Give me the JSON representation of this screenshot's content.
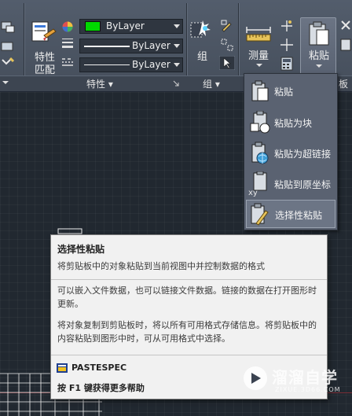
{
  "ribbon": {
    "match_properties_label": "特性\n匹配",
    "match_properties_line1": "特性",
    "match_properties_line2": "匹配",
    "color_combo": "ByLayer",
    "lineweight_combo": "ByLayer",
    "linetype_combo": "ByLayer",
    "group_label": "组",
    "measure_label": "测量",
    "paste_label": "粘贴",
    "panel_properties": "特性 ▾",
    "panel_groups": "组 ▾",
    "panel_partial": "板",
    "accent_color": "#00d800"
  },
  "paste_menu": {
    "items": [
      {
        "label": "粘贴",
        "icon": "clipboard-icon"
      },
      {
        "label": "粘贴为块",
        "icon": "paste-as-block-icon"
      },
      {
        "label": "粘贴为超链接",
        "icon": "paste-as-hyperlink-icon"
      },
      {
        "label": "粘贴到原坐标",
        "icon": "paste-to-original-coordinates-icon"
      },
      {
        "label": "选择性粘贴",
        "icon": "paste-special-icon"
      }
    ]
  },
  "tooltip": {
    "title": "选择性粘贴",
    "description": "将剪贴板中的对象粘贴到当前视图中并控制数据的格式",
    "detail1": "可以嵌入文件数据，也可以链接文件数据。链接的数据在打开图形时更新。",
    "detail2": "将对象复制到剪贴板时，将以所有可用格式存储信息。将剪贴板中的内容粘贴到图形中时，可从可用格式中选择。",
    "command": "PASTESPEC",
    "help": "按 F1 键获得更多帮助"
  },
  "watermark": {
    "text": "溜溜自学",
    "sub": "ZIXUE.3D66.COM"
  }
}
